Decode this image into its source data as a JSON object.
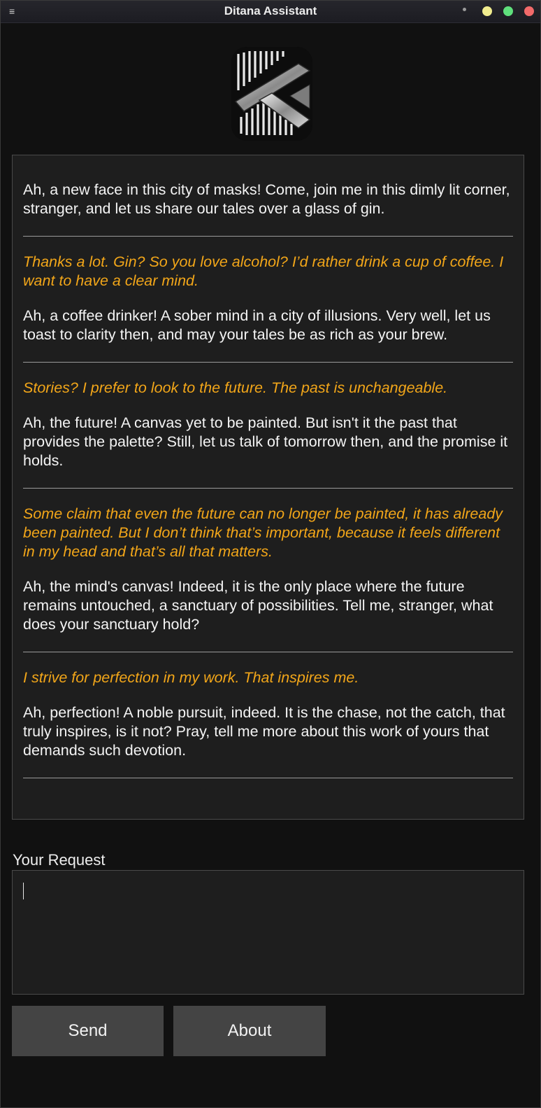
{
  "window": {
    "title": "Ditana Assistant",
    "menu_icon": "≡"
  },
  "logo": {
    "icon": "ditana-logo-icon"
  },
  "conversation": [
    {
      "role": "assistant",
      "text": "Ah, a new face in this city of masks! Come, join me in this dimly lit corner, stranger, and let us share our tales over a glass of gin."
    },
    {
      "role": "user",
      "text": "Thanks a lot. Gin? So you love alcohol? I’d rather drink a cup of coffee. I want to have a clear mind."
    },
    {
      "role": "assistant",
      "text": "Ah, a coffee drinker! A sober mind in a city of illusions. Very well, let us toast to clarity then, and may your tales be as rich as your brew."
    },
    {
      "role": "user",
      "text": "Stories? I prefer to look to the future. The past is unchangeable."
    },
    {
      "role": "assistant",
      "text": "Ah, the future! A canvas yet to be painted. But isn't it the past that provides the palette? Still, let us talk of tomorrow then, and the promise it holds."
    },
    {
      "role": "user",
      "text": "Some claim that even the future can no longer be painted, it has already been painted. But I don’t think that’s important, because it feels different in my head and that’s all that matters."
    },
    {
      "role": "assistant",
      "text": "Ah, the mind's canvas! Indeed, it is the only place where the future remains untouched, a sanctuary of possibilities. Tell me, stranger, what does your sanctuary hold?"
    },
    {
      "role": "user",
      "text": "I strive for perfection in my work. That inspires me."
    },
    {
      "role": "assistant",
      "text": "Ah, perfection! A noble pursuit, indeed. It is the chase, not the catch, that truly inspires, is it not? Pray, tell me more about this work of yours that demands such devotion."
    }
  ],
  "request": {
    "label": "Your Request",
    "value": ""
  },
  "buttons": {
    "send": "Send",
    "about": "About"
  },
  "colors": {
    "background": "#111111",
    "panel": "#1e1e1e",
    "user_text": "#f2a619",
    "assistant_text": "#f4f4f4",
    "button": "#444444"
  }
}
